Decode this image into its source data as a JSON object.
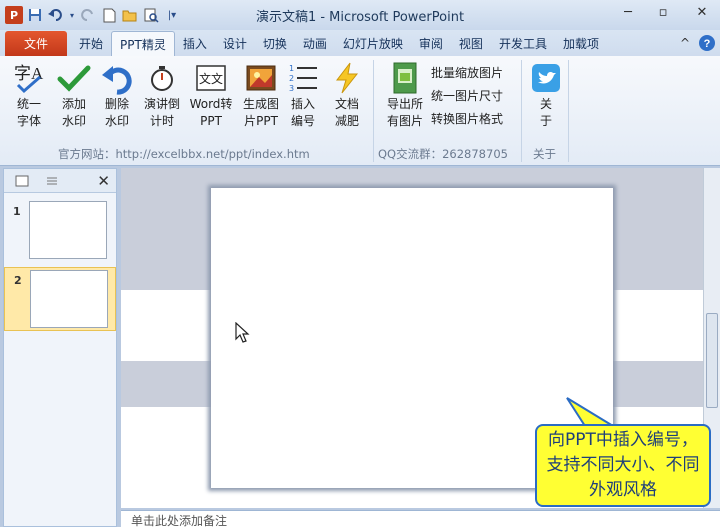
{
  "window": {
    "title": "演示文稿1 - Microsoft PowerPoint",
    "app_icon": "P",
    "controls": [
      "minimize-icon",
      "maximize-icon",
      "close-icon"
    ]
  },
  "quick_access": [
    "save-icon",
    "undo-icon",
    "redo-icon",
    "new-icon",
    "open-icon",
    "print-preview-icon",
    "customize-icon"
  ],
  "tabs": {
    "file": "文件",
    "items": [
      "开始",
      "PPT精灵",
      "插入",
      "设计",
      "切换",
      "动画",
      "幻灯片放映",
      "审阅",
      "视图",
      "开发工具",
      "加载项"
    ],
    "active": "PPT精灵"
  },
  "ribbon": {
    "buttons": [
      {
        "label": "统一\n字体",
        "icon": "font-icon"
      },
      {
        "label": "添加\n水印",
        "icon": "check-icon"
      },
      {
        "label": "删除\n水印",
        "icon": "undo-arrow-icon"
      },
      {
        "label": "演讲倒\n计时",
        "icon": "stopwatch-icon"
      },
      {
        "label": "Word转\nPPT",
        "icon": "word-doc-icon"
      },
      {
        "label": "生成图\n片PPT",
        "icon": "image-icon"
      },
      {
        "label": "插入\n编号",
        "icon": "numbered-list-icon"
      },
      {
        "label": "文档\n减肥",
        "icon": "lightning-icon"
      },
      {
        "label": "导出所\n有图片",
        "icon": "export-images-icon"
      },
      {
        "label": "关\n于",
        "icon": "twitter-bird-icon"
      }
    ],
    "small_buttons": [
      "批量缩放图片",
      "统一图片尺寸",
      "转换图片格式"
    ],
    "groups": {
      "website": "官方网站：http://excelbbx.net/ppt/index.htm",
      "qq": "QQ交流群：262878705",
      "about": "关于"
    }
  },
  "slides_panel": {
    "slides": [
      {
        "number": "1"
      },
      {
        "number": "2"
      }
    ],
    "selected": "2"
  },
  "notes": {
    "placeholder": "单击此处添加备注"
  },
  "callout": {
    "text": "向PPT中插入编号，支持不同大小、不同外观风格"
  }
}
